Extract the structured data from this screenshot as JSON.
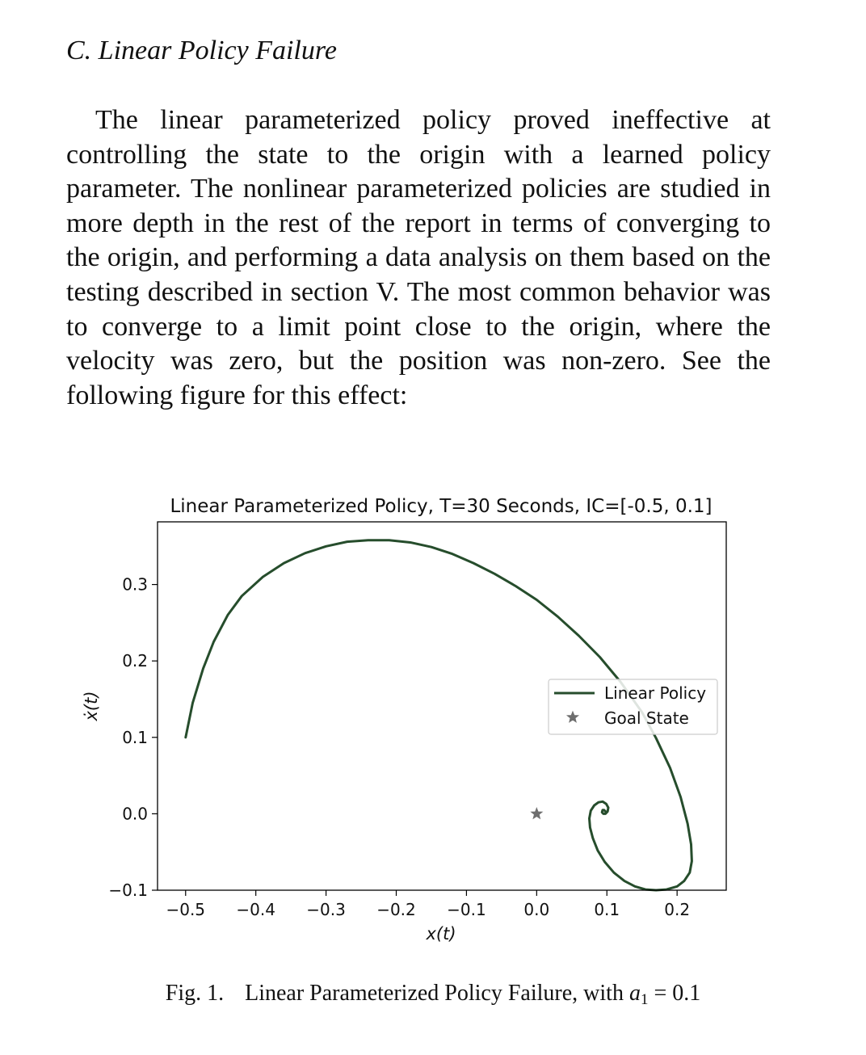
{
  "section": {
    "heading": "C.  Linear Policy Failure"
  },
  "body": {
    "paragraph": "The linear parameterized policy proved ineffective at controlling the state to the origin with a learned policy parameter. The nonlinear parameterized policies are studied in more depth in the rest of the report in terms of converging to the origin, and performing a data analysis on them based on the testing described in section V. The most common behavior was to converge to a limit point close to the origin, where the velocity was zero, but the position was non-zero. See the following figure for this effect:"
  },
  "caption": {
    "label": "Fig. 1.",
    "text": "Linear Parameterized Policy Failure, with ",
    "var": "a",
    "sub": "1",
    "rest": " = 0.1"
  },
  "chart_data": {
    "type": "line",
    "title": "Linear Parameterized Policy, T=30 Seconds, IC=[-0.5, 0.1]",
    "xlabel": "x(t)",
    "ylabel": "ẋ(t)",
    "xlim": [
      -0.54,
      0.27
    ],
    "ylim": [
      -0.1,
      0.382
    ],
    "xticks": [
      -0.5,
      -0.4,
      -0.3,
      -0.2,
      -0.1,
      0.0,
      0.1,
      0.2
    ],
    "xtick_labels": [
      "−0.5",
      "−0.4",
      "−0.3",
      "−0.2",
      "−0.1",
      "0.0",
      "0.1",
      "0.2"
    ],
    "yticks": [
      -0.1,
      0.0,
      0.1,
      0.2,
      0.3
    ],
    "ytick_labels": [
      "−0.1",
      "0.0",
      "0.1",
      "0.2",
      "0.3"
    ],
    "grid": false,
    "legend_position": "center-right",
    "series": [
      {
        "name": "Linear Policy",
        "color": "#264d2c",
        "x": [
          -0.5,
          -0.49,
          -0.475,
          -0.46,
          -0.44,
          -0.42,
          -0.39,
          -0.36,
          -0.33,
          -0.3,
          -0.27,
          -0.24,
          -0.21,
          -0.18,
          -0.15,
          -0.12,
          -0.09,
          -0.06,
          -0.03,
          0.0,
          0.03,
          0.06,
          0.09,
          0.12,
          0.15,
          0.17,
          0.19,
          0.205,
          0.215,
          0.22,
          0.221,
          0.218,
          0.21,
          0.2,
          0.185,
          0.17,
          0.155,
          0.14,
          0.125,
          0.11,
          0.097,
          0.087,
          0.08,
          0.076,
          0.075,
          0.077,
          0.082,
          0.088,
          0.094,
          0.099,
          0.102,
          0.101,
          0.098,
          0.095,
          0.093,
          0.094,
          0.096,
          0.098
        ],
        "y": [
          0.1,
          0.145,
          0.19,
          0.225,
          0.26,
          0.285,
          0.31,
          0.328,
          0.341,
          0.35,
          0.356,
          0.358,
          0.358,
          0.355,
          0.349,
          0.34,
          0.328,
          0.314,
          0.298,
          0.28,
          0.258,
          0.233,
          0.205,
          0.172,
          0.133,
          0.099,
          0.06,
          0.022,
          -0.013,
          -0.04,
          -0.062,
          -0.077,
          -0.088,
          -0.095,
          -0.099,
          -0.1,
          -0.099,
          -0.095,
          -0.088,
          -0.077,
          -0.063,
          -0.048,
          -0.032,
          -0.018,
          -0.006,
          0.004,
          0.011,
          0.015,
          0.016,
          0.013,
          0.008,
          0.003,
          0.0,
          0.0,
          0.002,
          0.005,
          0.005,
          0.003
        ]
      },
      {
        "name": "Goal State",
        "type": "scatter",
        "marker": "star",
        "color": "#6e6e6e",
        "x": [
          0.0
        ],
        "y": [
          0.0
        ]
      }
    ]
  }
}
